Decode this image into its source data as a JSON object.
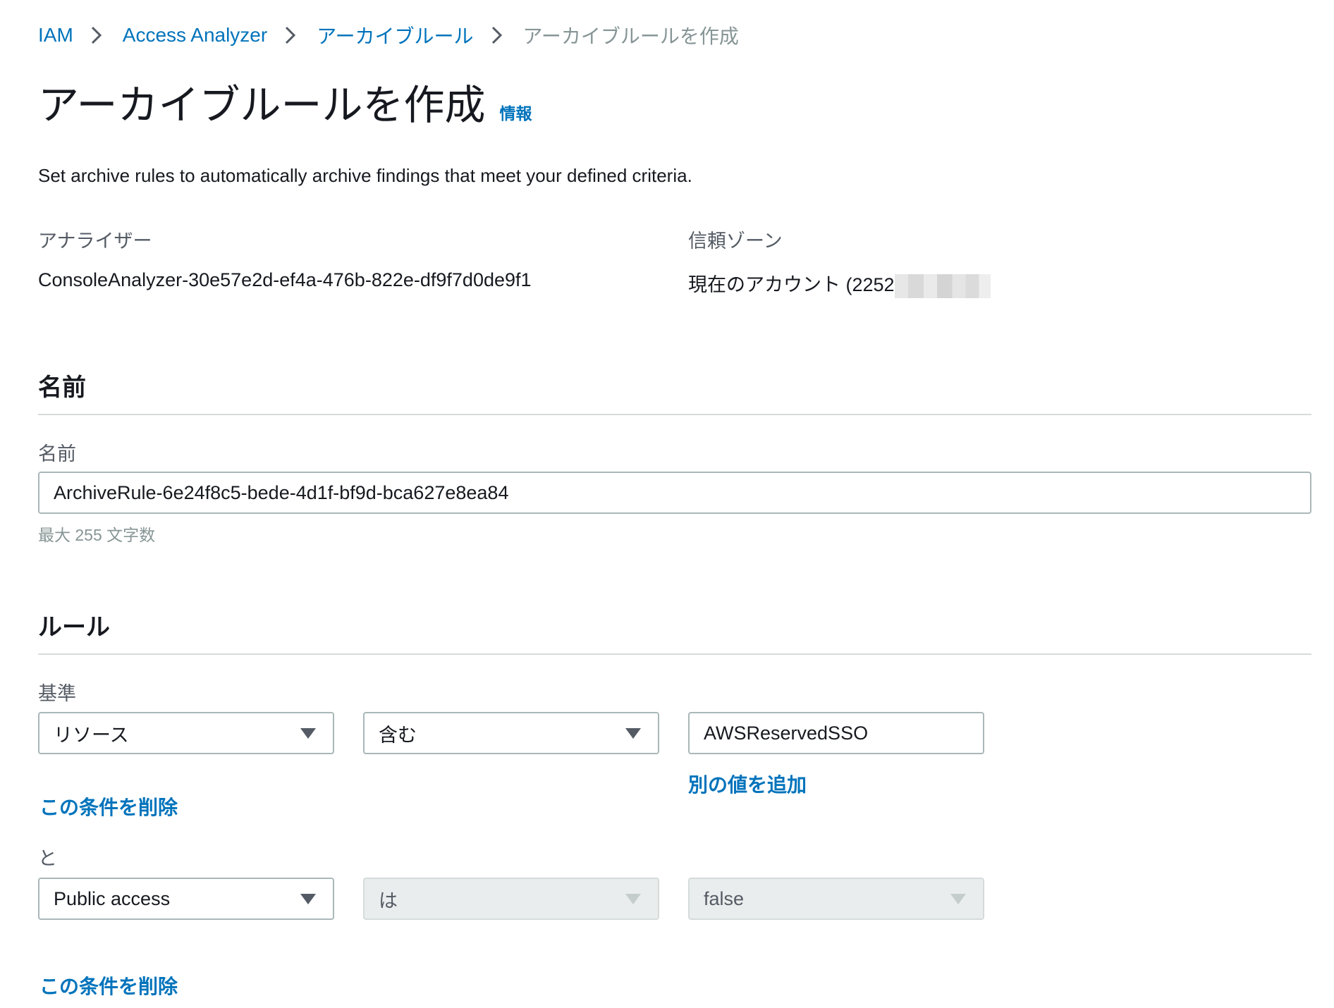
{
  "breadcrumb": {
    "items": [
      "IAM",
      "Access Analyzer",
      "アーカイブルール"
    ],
    "current": "アーカイブルールを作成"
  },
  "header": {
    "title": "アーカイブルールを作成",
    "info_link": "情報",
    "description": "Set archive rules to automatically archive findings that meet your defined criteria."
  },
  "analyzer": {
    "label": "アナライザー",
    "value": "ConsoleAnalyzer-30e57e2d-ef4a-476b-822e-df9f7d0de9f1"
  },
  "trust_zone": {
    "label": "信頼ゾーン",
    "value": "現在のアカウント (2252"
  },
  "name_section": {
    "heading": "名前",
    "field_label": "名前",
    "value": "ArchiveRule-6e24f8c5-bede-4d1f-bf9d-bca627e8ea84",
    "hint": "最大 255 文字数"
  },
  "rules_section": {
    "heading": "ルール",
    "criteria_label": "基準",
    "conditions": [
      {
        "property": "リソース",
        "operator": "含む",
        "value": "AWSReservedSSO",
        "add_value_link": "別の値を追加",
        "remove_link": "この条件を削除"
      },
      {
        "connector": "と",
        "property": "Public access",
        "operator": "は",
        "value": "false",
        "remove_link": "この条件を削除"
      }
    ]
  },
  "colors": {
    "link": "#0073bb",
    "text": "#16191f",
    "label": "#545b64",
    "muted": "#879596",
    "border": "#aab7b8",
    "divider": "#d5dbdb",
    "disabled_bg": "#eaeded"
  },
  "icons": {
    "breadcrumb_separator": "chevron-right-icon",
    "select_caret": "caret-down-icon"
  }
}
